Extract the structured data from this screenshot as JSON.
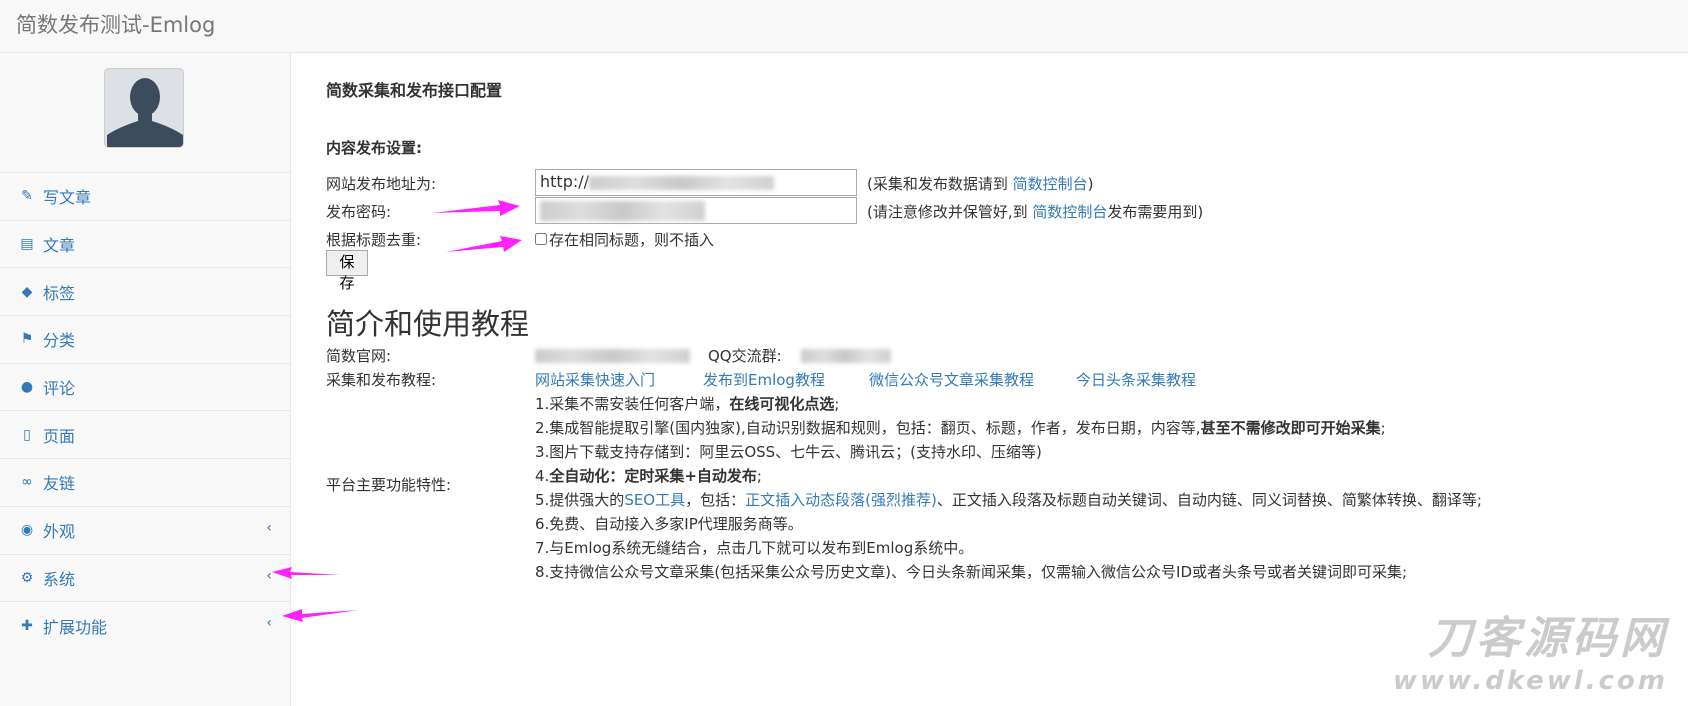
{
  "header": {
    "title": "简数发布测试-Emlog"
  },
  "sidebar": {
    "items": [
      {
        "label": "写文章",
        "icon": "edit-icon"
      },
      {
        "label": "文章",
        "icon": "list-icon"
      },
      {
        "label": "标签",
        "icon": "tags-icon"
      },
      {
        "label": "分类",
        "icon": "flag-icon"
      },
      {
        "label": "评论",
        "icon": "comments-icon"
      },
      {
        "label": "页面",
        "icon": "file-icon"
      },
      {
        "label": "友链",
        "icon": "link-icon"
      },
      {
        "label": "外观",
        "icon": "eye-icon",
        "chevron": true
      },
      {
        "label": "系统",
        "icon": "gear-icon",
        "chevron": true
      },
      {
        "label": "扩展功能",
        "icon": "puzzle-icon",
        "chevron": true
      }
    ]
  },
  "main": {
    "title": "简数采集和发布接口配置",
    "section": "内容发布设置:",
    "url_label": "网站发布地址为:",
    "url_value": "http://",
    "url_note_pre": "(采集和发布数据请到 ",
    "url_note_link": "简数控制台",
    "url_note_post": ")",
    "pwd_label": "发布密码:",
    "pwd_note_pre": "(请注意修改并保管好,到 ",
    "pwd_note_link": "简数控制台",
    "pwd_note_post": "发布需要用到)",
    "dedupe_label": "根据标题去重:",
    "dedupe_option": "存在相同标题，则不插入",
    "save": "保 存",
    "intro_title": "简介和使用教程",
    "site_label": "简数官网:",
    "qq_label": "QQ交流群:",
    "tutorial_label": "采集和发布教程:",
    "tutorials": [
      "网站采集快速入门",
      "发布到Emlog教程",
      "微信公众号文章采集教程",
      "今日头条采集教程"
    ],
    "features_label": "平台主要功能特性:",
    "f1a": "1.采集不需安装任何客户端，",
    "f1b": "在线可视化点选",
    "f1c": ";",
    "f2a": "2.集成智能提取引擎(国内独家),自动识别数据和规则，包括：翻页、标题，作者，发布日期，内容等,",
    "f2b": "甚至不需修改即可开始采集",
    ";f2c": ";",
    "f3": "3.图片下载支持存储到：阿里云OSS、七牛云、腾讯云；(支持水印、压缩等)",
    "f4a": "4.",
    "f4b": "全自动化：定时采集+自动发布",
    "f4c": ";",
    "f5a": "5.提供强大的",
    "f5b": "SEO工具",
    "f5c": "，包括：",
    "f5d": "正文插入动态段落(强烈推荐)",
    "f5e": "、正文插入段落及标题自动关键词、自动内链、同义词替换、简繁体转换、翻译等;",
    "f6": "6.免费、自动接入多家IP代理服务商等。",
    "f7": "7.与Emlog系统无缝结合，点击几下就可以发布到Emlog系统中。",
    "f8": "8.支持微信公众号文章采集(包括采集公众号历史文章)、今日头条新闻采集，仅需输入微信公众号ID或者头条号或者关键词即可采集;"
  },
  "watermark": {
    "text": "刀客源码网",
    "url": "www.dkewl.com"
  },
  "colors": {
    "link": "#337ab7",
    "arrow": "#ff22ff"
  }
}
